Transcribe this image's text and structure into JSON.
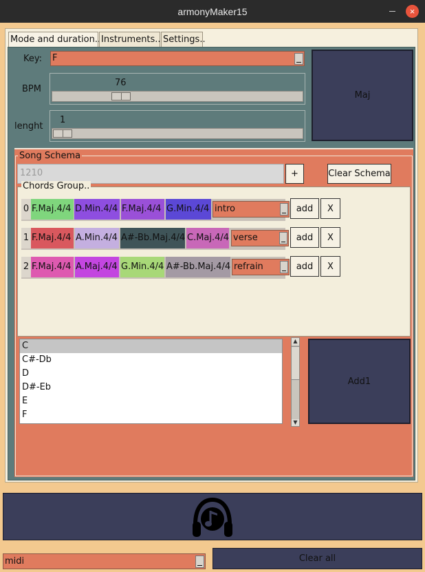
{
  "window": {
    "title": "armonyMaker15",
    "close_glyph": "×"
  },
  "tabs": [
    {
      "label": "Mode and duration.."
    },
    {
      "label": "Instruments.."
    },
    {
      "label": "Settings.."
    }
  ],
  "mode": {
    "key_label": "Key:",
    "key_value": "F",
    "bpm_label": "BPM",
    "bpm_value": "76",
    "length_label": "lenght",
    "length_value": "1",
    "mode_button": "Maj"
  },
  "song_schema": {
    "title": "Song Schema",
    "schema_value": "1210",
    "plus_label": "+",
    "clear_label": "Clear Schema"
  },
  "chords_group": {
    "title": "Chords Group..",
    "rows": [
      {
        "index": "0",
        "chords": [
          {
            "label": "F.Maj.4/4",
            "color": "#7fd67d"
          },
          {
            "label": "D.Min.4/4",
            "color": "#8e4ee0"
          },
          {
            "label": "F.Maj.4/4",
            "color": "#9a50d8"
          },
          {
            "label": "G.Min.4/4",
            "color": "#5b48d6"
          }
        ],
        "section": "intro",
        "add_label": "add",
        "remove_label": "X"
      },
      {
        "index": "1",
        "chords": [
          {
            "label": "F.Maj.4/4",
            "color": "#d9585e"
          },
          {
            "label": "A.Min.4/4",
            "color": "#c4afe0"
          },
          {
            "label": "A#-Bb.Maj.4/4",
            "color": "#3f5458"
          },
          {
            "label": "C.Maj.4/4",
            "color": "#c868b8"
          }
        ],
        "section": "verse",
        "add_label": "add",
        "remove_label": "X"
      },
      {
        "index": "2",
        "chords": [
          {
            "label": "F.Maj.4/4",
            "color": "#de5ab0"
          },
          {
            "label": "A.Maj.4/4",
            "color": "#c346e0"
          },
          {
            "label": "G.Min.4/4",
            "color": "#a8d878"
          },
          {
            "label": "A#-Bb.Maj.4/4",
            "color": "#a49aa4"
          }
        ],
        "section": "refrain",
        "add_label": "add",
        "remove_label": "X"
      }
    ]
  },
  "note_list": {
    "items": [
      "C",
      "C#-Db",
      "D",
      "D#-Eb",
      "E",
      "F"
    ],
    "selected": "C",
    "add_label": "Add1"
  },
  "player": {
    "icon": "headphones-music-icon"
  },
  "footer": {
    "output_value": "midi",
    "clear_all_label": "Clear all"
  }
}
